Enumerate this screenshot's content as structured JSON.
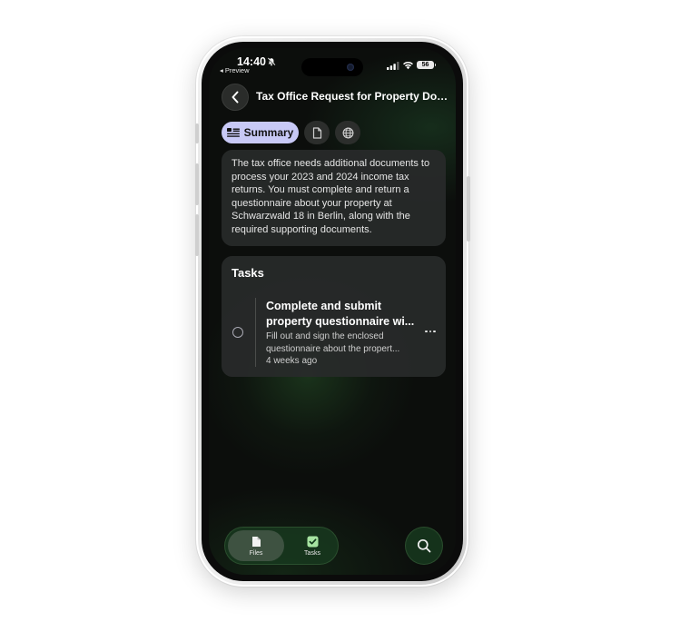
{
  "status_bar": {
    "time": "14:40",
    "back_app": "◂ Preview",
    "battery": "56"
  },
  "header": {
    "title": "Tax Office Request for Property Documents"
  },
  "tabs": {
    "summary_label": "Summary",
    "active": "summary"
  },
  "summary": {
    "text": "The tax office needs additional documents to process your 2023 and 2024 income tax returns. You must complete and return a questionnaire about your property at Schwarzwald 18 in Berlin, along with the required supporting documents."
  },
  "tasks": {
    "heading": "Tasks",
    "items": [
      {
        "title_line1": "Complete and submit",
        "title_line2": "property questionnaire wi...",
        "desc_line1": "Fill out and sign the enclosed",
        "desc_line2": "questionnaire about the propert...",
        "time": "4 weeks ago",
        "completed": false
      }
    ]
  },
  "bottom_nav": {
    "files_label": "Files",
    "tasks_label": "Tasks",
    "active": "files"
  },
  "icons": {
    "back": "chevron-left-icon",
    "summary": "summary-lines-icon",
    "document": "document-icon",
    "globe": "globe-icon",
    "files": "file-icon",
    "tasks": "checkbox-icon",
    "search": "search-icon",
    "more": "ellipsis-icon"
  },
  "colors": {
    "accent_tab": "#c8c9f6",
    "card_bg": "#282a2a",
    "nav_bg": "#18381e",
    "task_check_green": "#a6e3a1"
  }
}
